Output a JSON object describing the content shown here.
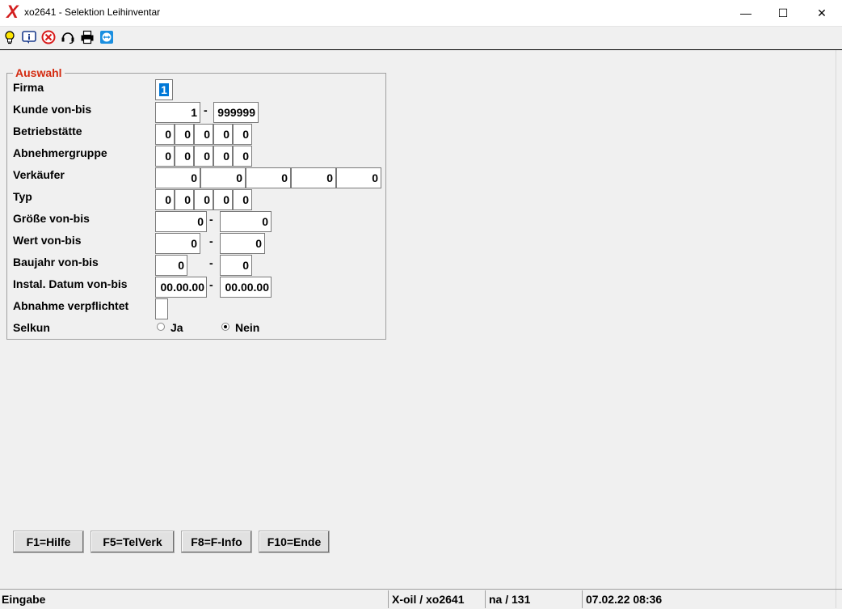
{
  "window": {
    "title": "xo2641 - Selektion Leihinventar",
    "logo": "X",
    "minimize_glyph": "—",
    "maximize_glyph": "☐",
    "close_glyph": "✕"
  },
  "toolbar": {
    "icons": [
      "lightbulb-icon",
      "info-icon",
      "stop-icon",
      "headset-icon",
      "printer-icon",
      "teamviewer-icon"
    ]
  },
  "group": {
    "title": "Auswahl",
    "fields": {
      "firma": {
        "label": "Firma",
        "value": "1"
      },
      "kunde": {
        "label": "Kunde von-bis",
        "from": "1",
        "to": "999999"
      },
      "betriebstaette": {
        "label": "Betriebstätte",
        "values": [
          "0",
          "0",
          "0",
          "0",
          "0"
        ]
      },
      "abnehmergruppe": {
        "label": "Abnehmergruppe",
        "values": [
          "0",
          "0",
          "0",
          "0",
          "0"
        ]
      },
      "verkaeufer": {
        "label": "Verkäufer",
        "values": [
          "0",
          "0",
          "0",
          "0",
          "0"
        ]
      },
      "typ": {
        "label": "Typ",
        "values": [
          "0",
          "0",
          "0",
          "0",
          "0"
        ]
      },
      "groesse": {
        "label": "Größe von-bis",
        "from": "0",
        "to": "0"
      },
      "wert": {
        "label": "Wert von-bis",
        "from": "0",
        "to": "0"
      },
      "baujahr": {
        "label": "Baujahr von-bis",
        "from": "0",
        "to": "0"
      },
      "instal": {
        "label": "Instal. Datum von-bis",
        "from": "00.00.00",
        "to": "00.00.00"
      },
      "abnahme": {
        "label": "Abnahme verpflichtet",
        "value": ""
      },
      "selkun": {
        "label": "Selkun",
        "option_ja": "Ja",
        "option_nein": "Nein",
        "selected": "Nein"
      }
    },
    "dash": "-"
  },
  "function_keys": {
    "f1": "F1=Hilfe",
    "f5": "F5=TelVerk",
    "f8": "F8=F-Info",
    "f10": "F10=Ende"
  },
  "status": {
    "mode": "Eingabe",
    "app": "X-oil / xo2641",
    "user": "na / 131",
    "datetime": "07.02.22 08:36"
  }
}
